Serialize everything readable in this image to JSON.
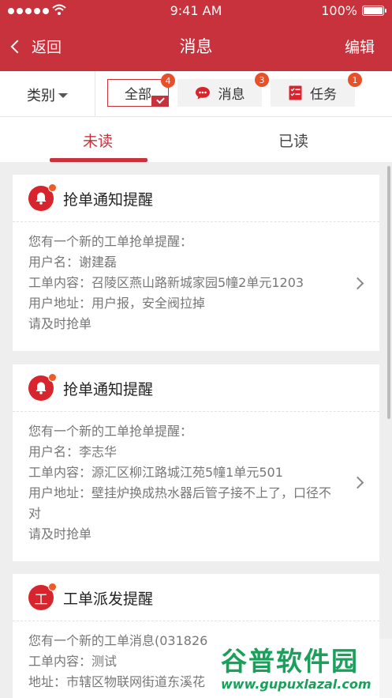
{
  "status_bar": {
    "time": "9:41 AM",
    "battery": "100%"
  },
  "nav": {
    "back": "返回",
    "title": "消息",
    "edit": "编辑"
  },
  "filter": {
    "category": "类别",
    "chips": [
      {
        "label": "全部",
        "badge": "4",
        "icon": "none"
      },
      {
        "label": "消息",
        "badge": "3",
        "icon": "chat-bubble-icon"
      },
      {
        "label": "任务",
        "badge": "1",
        "icon": "task-list-icon"
      }
    ]
  },
  "tabs": {
    "unread": "未读",
    "read": "已读"
  },
  "cards": [
    {
      "icon": "bell-icon",
      "title": "抢单通知提醒",
      "lines": [
        "您有一个新的工单抢单提醒：",
        "用户名：谢建磊",
        "工单内容：召陵区燕山路新城家园5幢2单元1203",
        "用户地址：用户报，安全阀拉掉",
        "请及时抢单"
      ]
    },
    {
      "icon": "bell-icon",
      "title": "抢单通知提醒",
      "lines": [
        "您有一个新的工单抢单提醒：",
        "用户名：李志华",
        "工单内容：源汇区柳江路城江苑5幢1单元501",
        "用户地址：壁挂炉换成热水器后管子接不上了，口径不对",
        "请及时抢单"
      ]
    },
    {
      "icon_text": "工",
      "title": "工单派发提醒",
      "lines": [
        "您有一个新的工单消息(031826",
        "工单内容：测试",
        "地址：市辖区物联网街道东溪花"
      ]
    }
  ],
  "watermark": {
    "name": "谷普软件园",
    "url": "www.gupuxlazal.com"
  },
  "colors": {
    "brand_red": "#c8323c",
    "badge_orange": "#e8502a",
    "watermark_green": "#1aa05a"
  }
}
